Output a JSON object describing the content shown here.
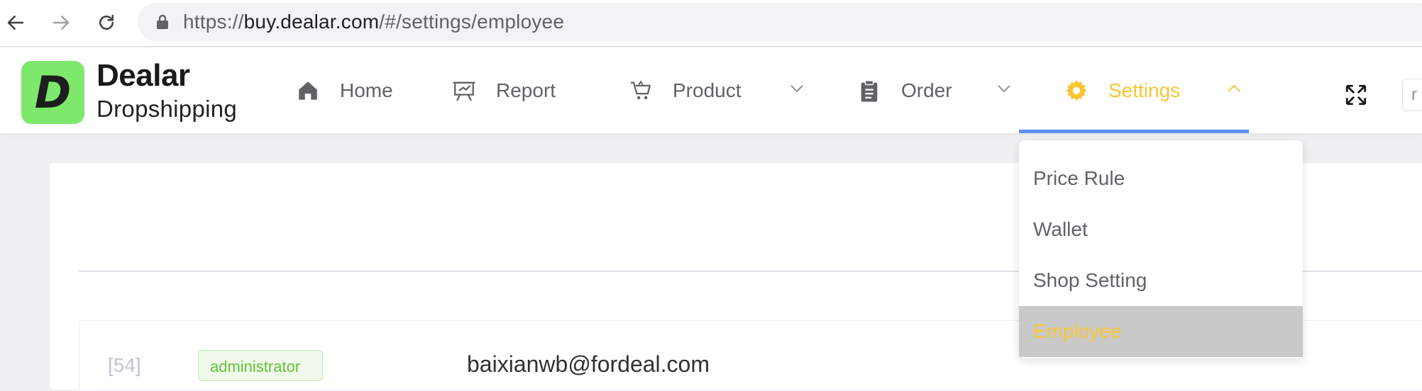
{
  "browser": {
    "url_prefix": "https://",
    "url_host": "buy.dealar.com",
    "url_path": "/#/settings/employee"
  },
  "brand": {
    "logo_letter": "D",
    "name": "Dealar",
    "subtitle": "Dropshipping",
    "logo_color": "#7de86b"
  },
  "menu": {
    "items": [
      {
        "label": "Home",
        "icon": "home-icon"
      },
      {
        "label": "Report",
        "icon": "presentation-board-icon"
      },
      {
        "label": "Product",
        "icon": "shopping-cart-icon"
      },
      {
        "label": "Order",
        "icon": "clipboard-icon"
      },
      {
        "label": "Settings",
        "icon": "gear-icon"
      }
    ],
    "active": "Settings",
    "active_color": "#f7c634",
    "underline_color": "#5b8ff9"
  },
  "header_input": {
    "value": "r"
  },
  "dropdown": {
    "items": [
      {
        "label": "Price Rule"
      },
      {
        "label": "Wallet"
      },
      {
        "label": "Shop Setting"
      },
      {
        "label": "Employee"
      }
    ],
    "selected": "Employee"
  },
  "employee_row": {
    "id": "[54]",
    "role": "administrator",
    "email": "baixianwb@fordeal.com"
  }
}
